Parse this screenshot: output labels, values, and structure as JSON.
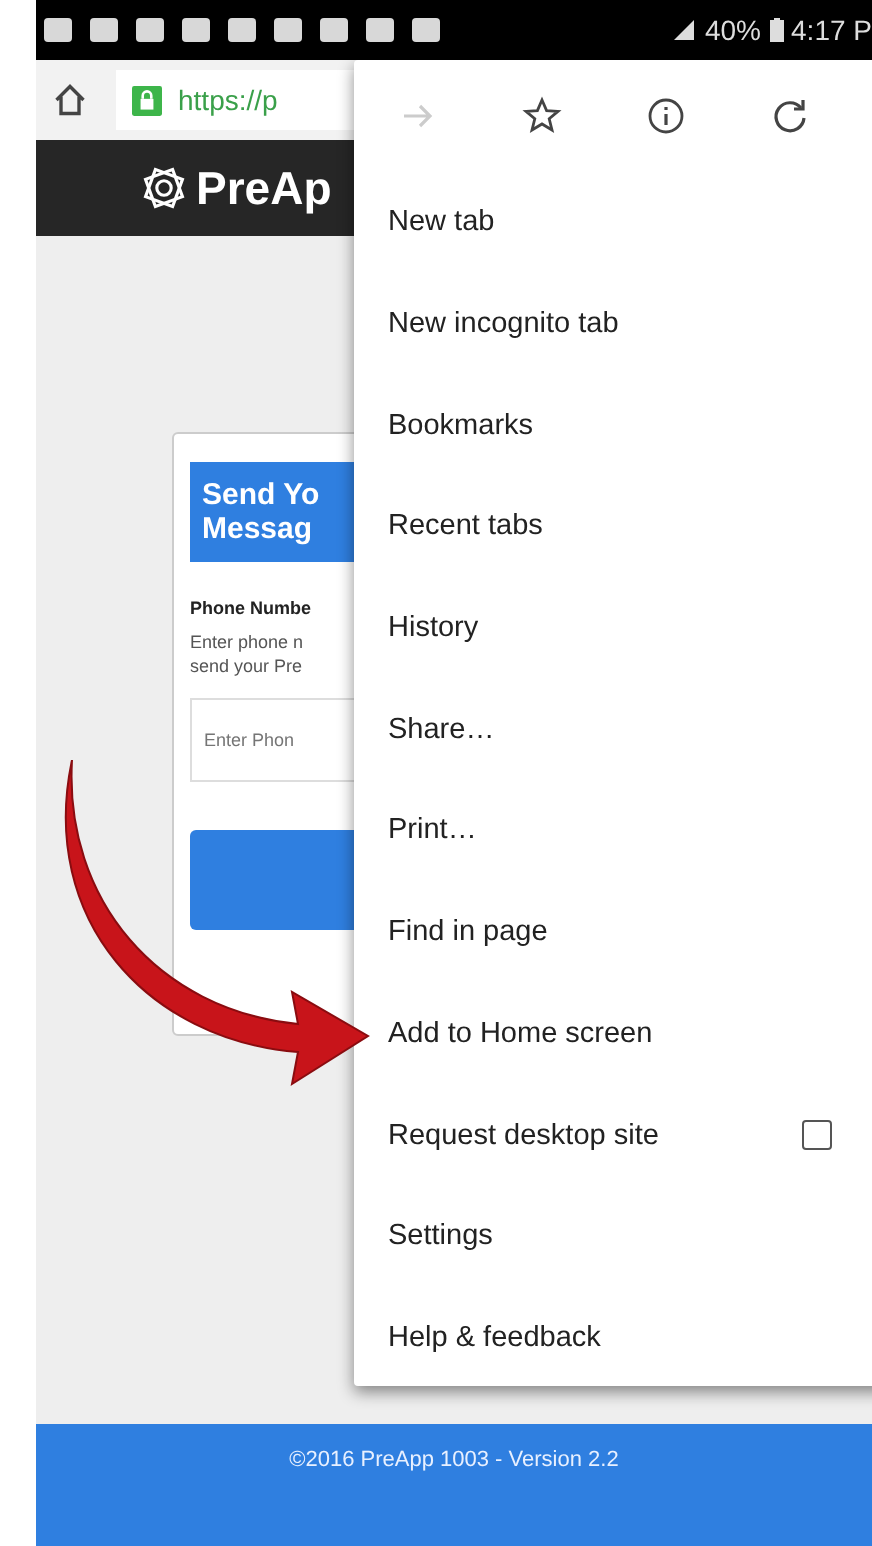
{
  "status_bar": {
    "battery": "40%",
    "time": "4:17 P"
  },
  "toolbar": {
    "url": "https://p"
  },
  "header": {
    "logo_text": "PreAp"
  },
  "card": {
    "title_lines": [
      "Send Yo",
      "Messag"
    ],
    "label": "Phone Numbe",
    "help_lines": [
      "Enter phone n",
      "send your Pre"
    ],
    "placeholder": "Enter Phon"
  },
  "menu": {
    "icons": [
      {
        "kind": "forward",
        "disabled": true
      },
      {
        "kind": "star",
        "disabled": false
      },
      {
        "kind": "info",
        "disabled": false
      },
      {
        "kind": "reload",
        "disabled": false
      }
    ],
    "items": [
      {
        "label": "New tab",
        "kind": "text"
      },
      {
        "label": "New incognito tab",
        "kind": "text"
      },
      {
        "label": "Bookmarks",
        "kind": "text"
      },
      {
        "label": "Recent tabs",
        "kind": "text"
      },
      {
        "label": "History",
        "kind": "text"
      },
      {
        "label": "Share…",
        "kind": "text"
      },
      {
        "label": "Print…",
        "kind": "text"
      },
      {
        "label": "Find in page",
        "kind": "text"
      },
      {
        "label": "Add to Home screen",
        "kind": "text"
      },
      {
        "label": "Request desktop site",
        "kind": "checkbox",
        "checked": false
      },
      {
        "label": "Settings",
        "kind": "text"
      },
      {
        "label": "Help & feedback",
        "kind": "text"
      }
    ]
  },
  "footer": {
    "text": "©2016 PreApp 1003 - Version 2.2"
  }
}
